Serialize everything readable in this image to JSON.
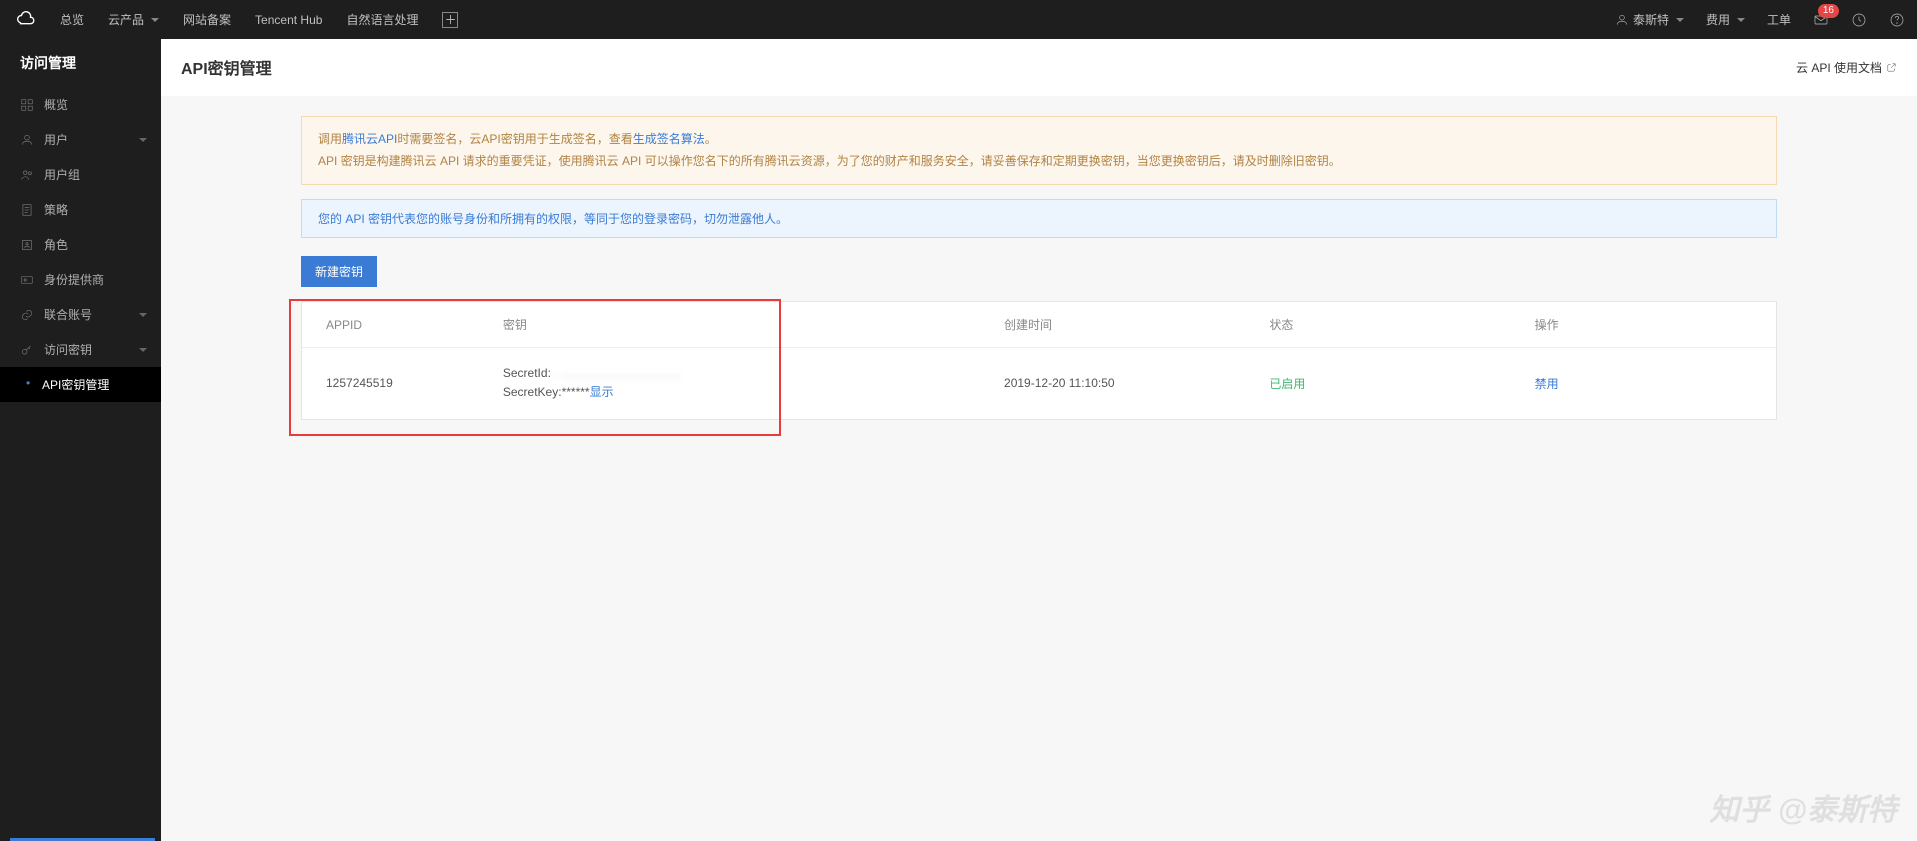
{
  "topbar": {
    "nav": [
      "总览",
      "云产品",
      "网站备案",
      "Tencent Hub",
      "自然语言处理"
    ],
    "user": "泰斯特",
    "fee": "费用",
    "order": "工单",
    "badge": "16"
  },
  "sidebar": {
    "title": "访问管理",
    "items": [
      {
        "label": "概览",
        "icon": "grid"
      },
      {
        "label": "用户",
        "icon": "user",
        "expand": true
      },
      {
        "label": "用户组",
        "icon": "group"
      },
      {
        "label": "策略",
        "icon": "doc"
      },
      {
        "label": "角色",
        "icon": "role"
      },
      {
        "label": "身份提供商",
        "icon": "card"
      },
      {
        "label": "联合账号",
        "icon": "link",
        "expand": true
      },
      {
        "label": "访问密钥",
        "icon": "key",
        "expand": true
      }
    ],
    "subitem": "API密钥管理"
  },
  "page": {
    "title": "API密钥管理",
    "doc_link": "云 API 使用文档"
  },
  "alerts": {
    "warning_prefix": "调用",
    "warning_link1": "腾讯云API",
    "warning_mid1": "时需要签名，云API密钥用于生成签名，查看",
    "warning_link2": "生成签名算法",
    "warning_suffix": "。",
    "warning_line2": "API 密钥是构建腾讯云 API 请求的重要凭证，使用腾讯云 API 可以操作您名下的所有腾讯云资源，为了您的财产和服务安全，请妥善保存和定期更换密钥，当您更换密钥后，请及时删除旧密钥。",
    "info": "您的 API 密钥代表您的账号身份和所拥有的权限，等同于您的登录密码，切勿泄露他人。"
  },
  "button": {
    "new_key": "新建密钥"
  },
  "table": {
    "headers": [
      "APPID",
      "密钥",
      "创建时间",
      "状态",
      "操作"
    ],
    "row": {
      "appid": "1257245519",
      "secret_id_label": "SecretId: ",
      "secret_id_val": ". …………………………",
      "secret_key_label": "SecretKey:",
      "secret_key_mask": "******",
      "show": "显示",
      "created": "2019-12-20 11:10:50",
      "status": "已启用",
      "action": "禁用"
    }
  },
  "watermark": "知乎 @泰斯特"
}
